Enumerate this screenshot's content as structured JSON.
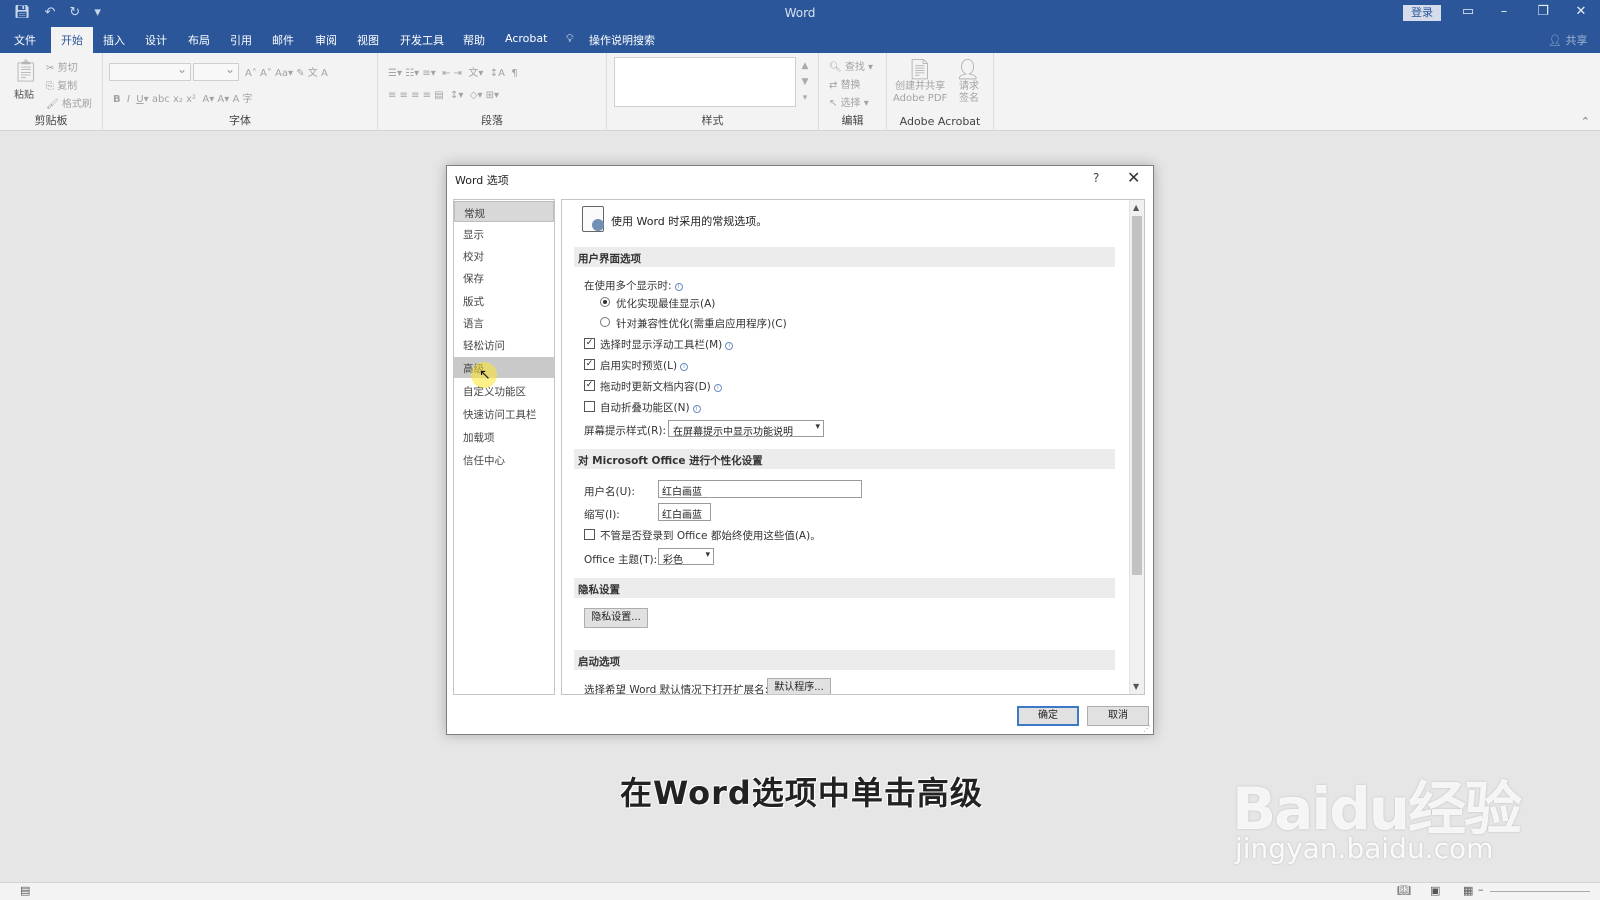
{
  "window": {
    "title": "Word",
    "login_label": "登录",
    "qat_icons": [
      "save-icon",
      "undo-icon",
      "redo-icon",
      "customize-qat-icon"
    ]
  },
  "tabs": [
    "文件",
    "开始",
    "插入",
    "设计",
    "布局",
    "引用",
    "邮件",
    "审阅",
    "视图",
    "开发工具",
    "帮助",
    "Acrobat"
  ],
  "active_tab": "开始",
  "tell_me": "操作说明搜索",
  "share_label": "共享",
  "ribbon": {
    "groups": [
      "剪贴板",
      "字体",
      "段落",
      "样式",
      "编辑",
      "Adobe Acrobat"
    ],
    "clipboard": {
      "paste": "粘贴",
      "cut": "剪切",
      "copy": "复制",
      "format_painter": "格式刷"
    },
    "editing": {
      "find": "查找",
      "replace": "替换",
      "select": "选择"
    },
    "acrobat": {
      "create_share": "创建并共享\nAdobe PDF",
      "request_sign": "请求\n签名"
    },
    "font_buttons": [
      "B",
      "I",
      "U",
      "abc",
      "x₂",
      "x²",
      "A",
      "A",
      "A",
      "字"
    ]
  },
  "dialog": {
    "title": "Word 选项",
    "help": "?",
    "close": "✕",
    "nav": [
      "常规",
      "显示",
      "校对",
      "保存",
      "版式",
      "语言",
      "轻松访问",
      "高级",
      "自定义功能区",
      "快速访问工具栏",
      "加载项",
      "信任中心"
    ],
    "selected_nav": "常规",
    "hover_nav": "高级",
    "header": "使用 Word 时采用的常规选项。",
    "ui_section": {
      "title": "用户界面选项",
      "multi_display_label": "在使用多个显示时:",
      "radio_optimize": "优化实现最佳显示(A)",
      "radio_compat": "针对兼容性优化(需重启应用程序)(C)",
      "cb_minitoolbar": "选择时显示浮动工具栏(M)",
      "cb_livepreview": "启用实时预览(L)",
      "cb_update_drag": "拖动时更新文档内容(D)",
      "cb_collapse_ribbon": "自动折叠功能区(N)",
      "screentip_label": "屏幕提示样式(R):",
      "screentip_value": "在屏幕提示中显示功能说明"
    },
    "personalize_section": {
      "title": "对 Microsoft Office 进行个性化设置",
      "username_label": "用户名(U):",
      "username_value": "红白画蓝",
      "initials_label": "缩写(I):",
      "initials_value": "红白画蓝",
      "always_use_label": "不管是否登录到 Office 都始终使用这些值(A)。",
      "theme_label": "Office 主题(T):",
      "theme_value": "彩色"
    },
    "privacy_section": {
      "title": "隐私设置",
      "button": "隐私设置..."
    },
    "startup_section": {
      "title": "启动选项",
      "default_label": "选择希望 Word 默认情况下打开扩展名:",
      "default_button": "默认程序..."
    },
    "ok": "确定",
    "cancel": "取消"
  },
  "caption": "在Word选项中单击高级",
  "watermark": {
    "logo": "Baidu经验",
    "url": "jingyan.baidu.com"
  }
}
